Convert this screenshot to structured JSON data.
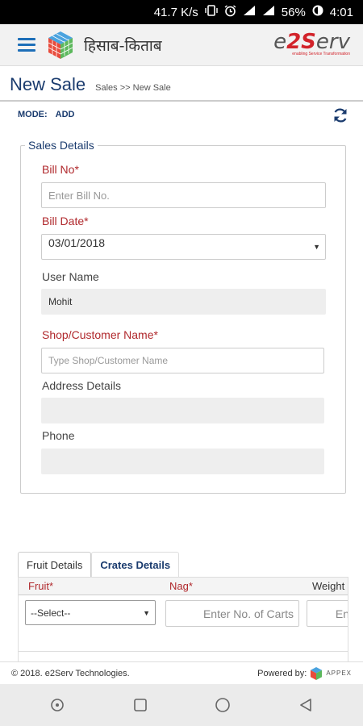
{
  "status_bar": {
    "speed": "41.7 K/s",
    "battery": "56%",
    "time": "4:01"
  },
  "header": {
    "app_title": "हिसाब-किताब",
    "brand_name_left": "e",
    "brand_name_mid": "2S",
    "brand_name_right": "erv",
    "brand_tagline": "enabling Service Transformation"
  },
  "page": {
    "title": "New Sale",
    "breadcrumb": "Sales >> New Sale"
  },
  "mode": {
    "label": "MODE:",
    "value": "ADD"
  },
  "sales_details": {
    "legend": "Sales Details",
    "bill_no_label": "Bill No*",
    "bill_no_placeholder": "Enter Bill No.",
    "bill_date_label": "Bill Date*",
    "bill_date_value": "03/01/2018",
    "user_name_label": "User Name",
    "user_name_value": "Mohit",
    "shop_label": "Shop/Customer Name*",
    "shop_placeholder": "Type Shop/Customer Name",
    "address_label": "Address Details",
    "address_value": "",
    "phone_label": "Phone",
    "phone_value": ""
  },
  "tabs": {
    "items": [
      {
        "label": "Fruit Details"
      },
      {
        "label": "Crates Details"
      }
    ]
  },
  "fruit_grid": {
    "col_fruit": "Fruit*",
    "col_nag": "Nag*",
    "col_weight": "Weight",
    "fruit_select": "--Select--",
    "nag_placeholder": "Enter No. of Carts",
    "weight_placeholder": "En"
  },
  "footer": {
    "copyright": "© 2018. e2Serv Technologies.",
    "powered_by": "Powered by:",
    "appex": "APPEX"
  },
  "colors": {
    "accent": "#1a3b6e",
    "required": "#b0282c",
    "brand_red": "#d2232a"
  }
}
